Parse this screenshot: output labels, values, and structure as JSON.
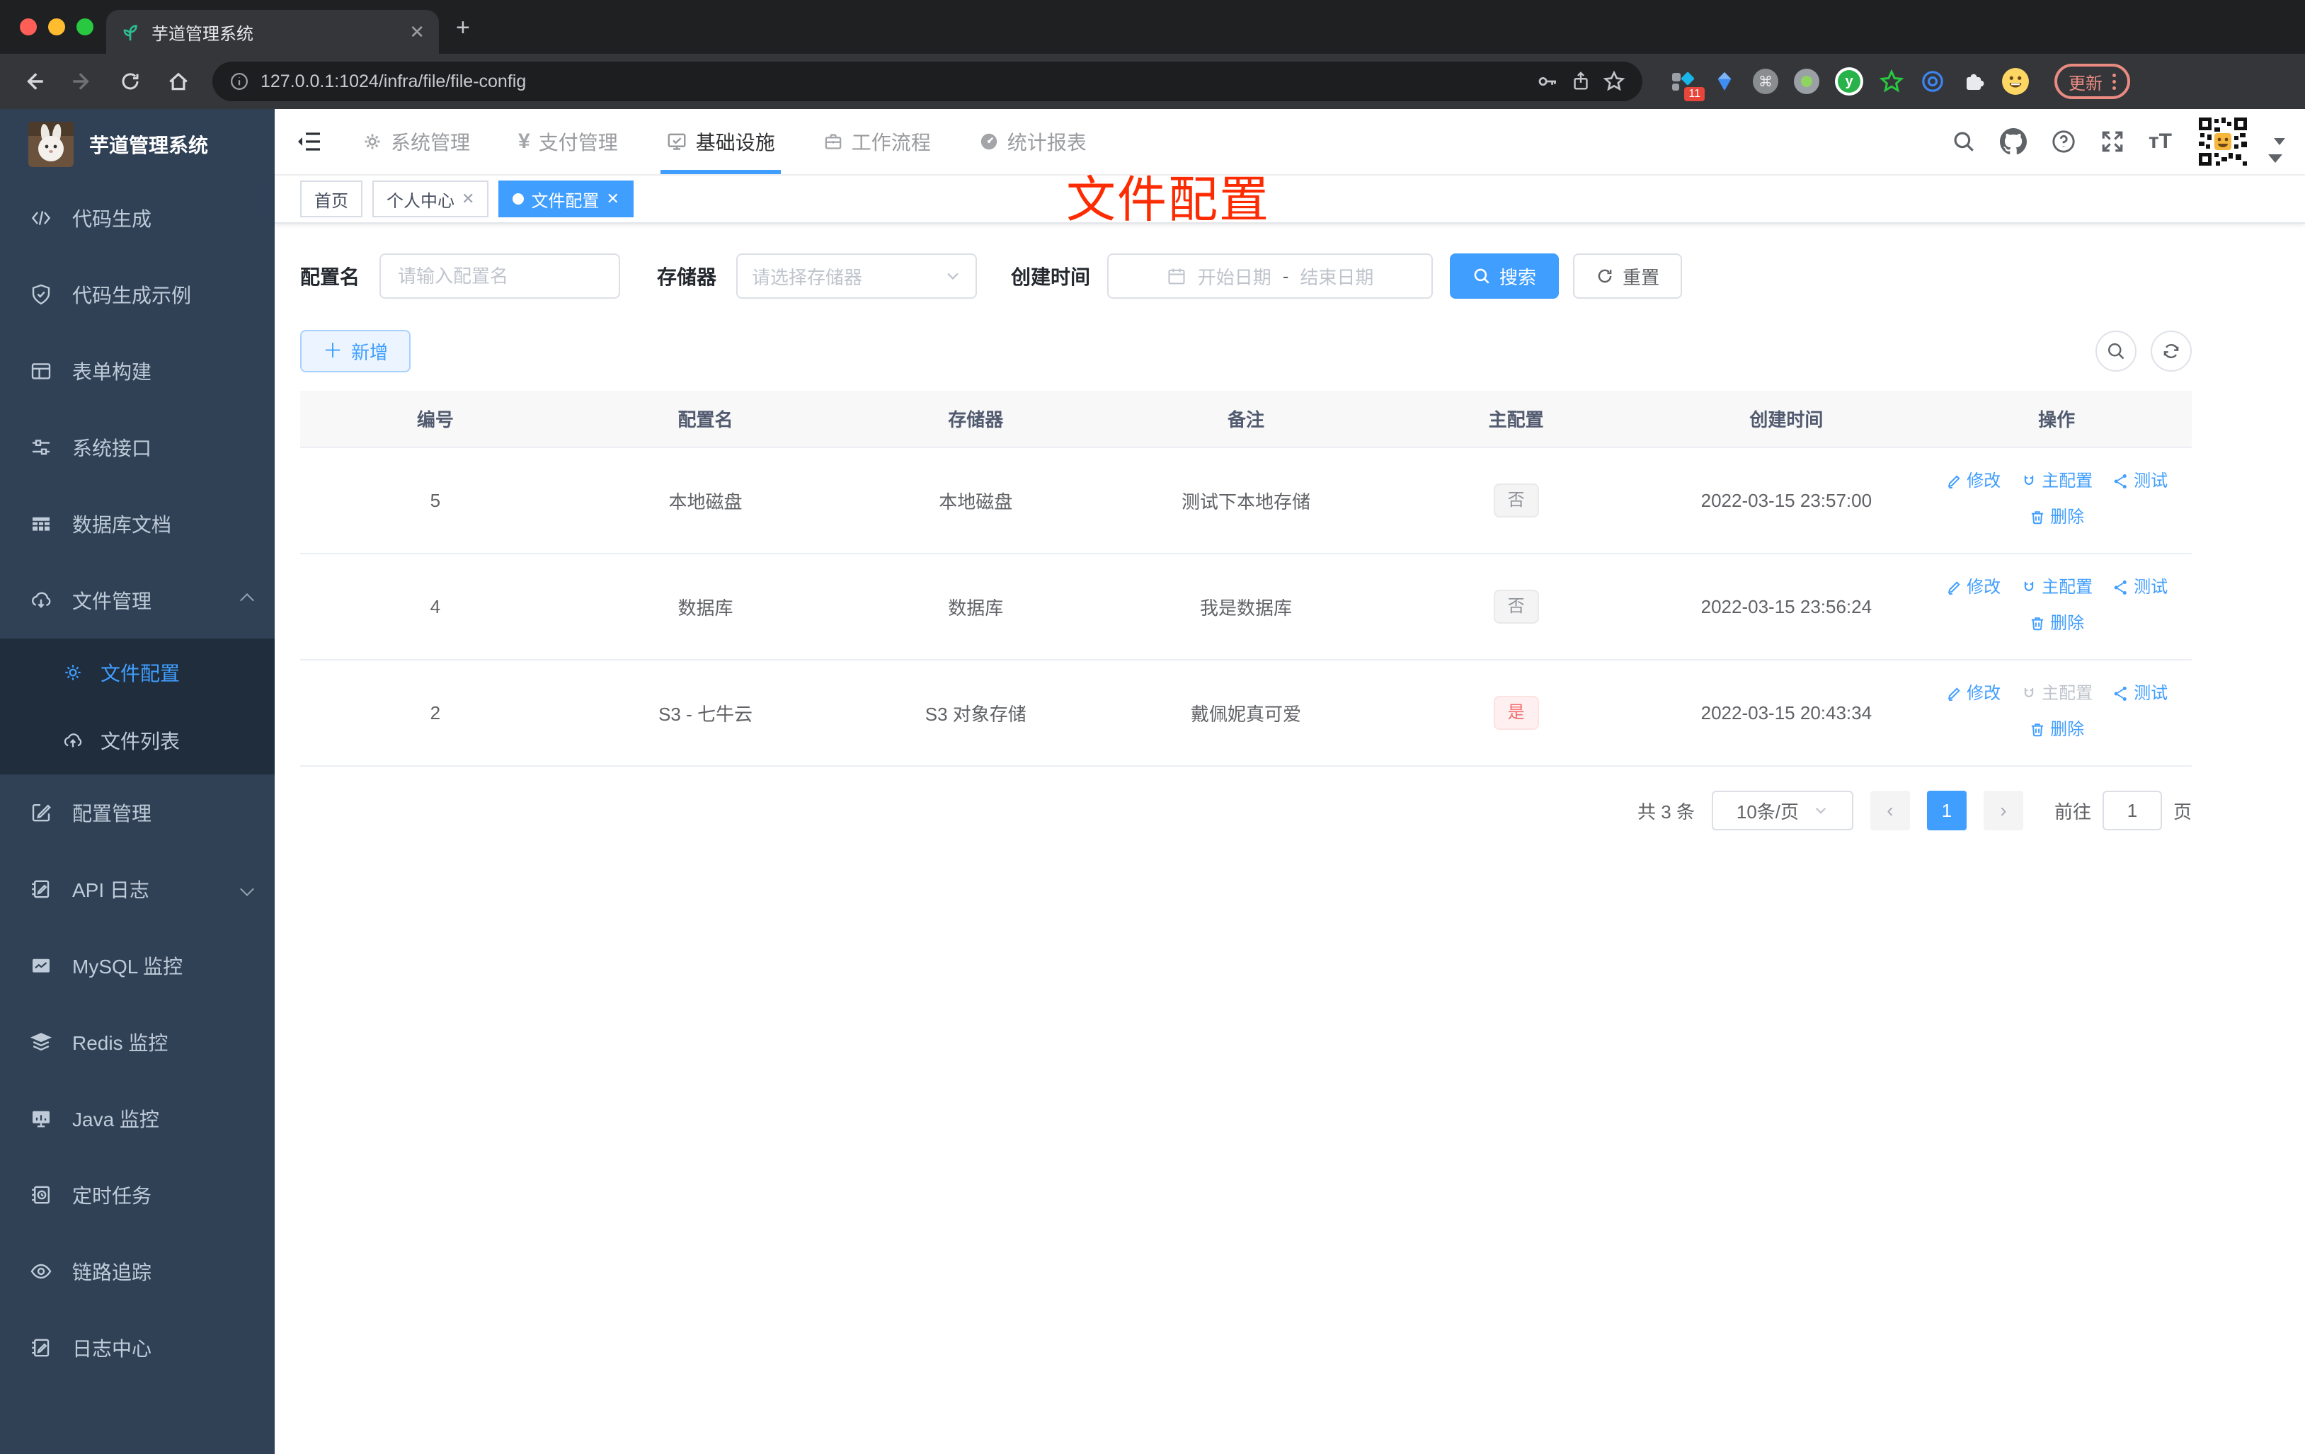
{
  "browser": {
    "tab_title": "芋道管理系统",
    "url": "127.0.0.1:1024/infra/file/file-config",
    "update_label": "更新",
    "ext_badge": "11"
  },
  "colors": {
    "accent": "#409eff",
    "sidebar_bg": "#304156",
    "submenu_bg": "#1f2d3d",
    "annotation_red": "#fd2b02",
    "tag_yes_text": "#f56c6c",
    "tag_no_text": "#909399"
  },
  "sidebar": {
    "logo_title": "芋道管理系统",
    "menu_top": [
      "代码生成",
      "代码生成示例",
      "表单构建",
      "系统接口",
      "数据库文档",
      "文件管理"
    ],
    "submenu": [
      "文件配置",
      "文件列表"
    ],
    "menu_bottom": [
      "配置管理",
      "API 日志",
      "MySQL 监控",
      "Redis 监控",
      "Java 监控",
      "定时任务",
      "链路追踪",
      "日志中心"
    ]
  },
  "topnav": {
    "menu": [
      "系统管理",
      "支付管理",
      "基础设施",
      "工作流程",
      "统计报表"
    ],
    "active": "基础设施"
  },
  "tags": {
    "home": "首页",
    "personal": "个人中心",
    "file_config": "文件配置"
  },
  "annotation": "文件配置",
  "filters": {
    "name_label": "配置名",
    "name_placeholder": "请输入配置名",
    "storage_label": "存储器",
    "storage_placeholder": "请选择存储器",
    "time_label": "创建时间",
    "start_placeholder": "开始日期",
    "range_separator": "-",
    "end_placeholder": "结束日期",
    "search_label": "搜索",
    "reset_label": "重置"
  },
  "toolbar": {
    "add_label": "新增"
  },
  "table": {
    "columns": [
      "编号",
      "配置名",
      "存储器",
      "备注",
      "主配置",
      "创建时间",
      "操作"
    ],
    "actions": {
      "edit": "修改",
      "master": "主配置",
      "test": "测试",
      "delete": "删除"
    },
    "rows": [
      {
        "id": "5",
        "name": "本地磁盘",
        "storage": "本地磁盘",
        "remark": "测试下本地存储",
        "master": "否",
        "created": "2022-03-15 23:57:00"
      },
      {
        "id": "4",
        "name": "数据库",
        "storage": "数据库",
        "remark": "我是数据库",
        "master": "否",
        "created": "2022-03-15 23:56:24"
      },
      {
        "id": "2",
        "name": "S3 - 七牛云",
        "storage": "S3 对象存储",
        "remark": "戴佩妮真可爱",
        "master": "是",
        "created": "2022-03-15 20:43:34"
      }
    ]
  },
  "pagination": {
    "total": "共 3 条",
    "page_size": "10条/页",
    "current_page": "1",
    "goto_label": "前往",
    "goto_value": "1",
    "page_unit": "页"
  }
}
